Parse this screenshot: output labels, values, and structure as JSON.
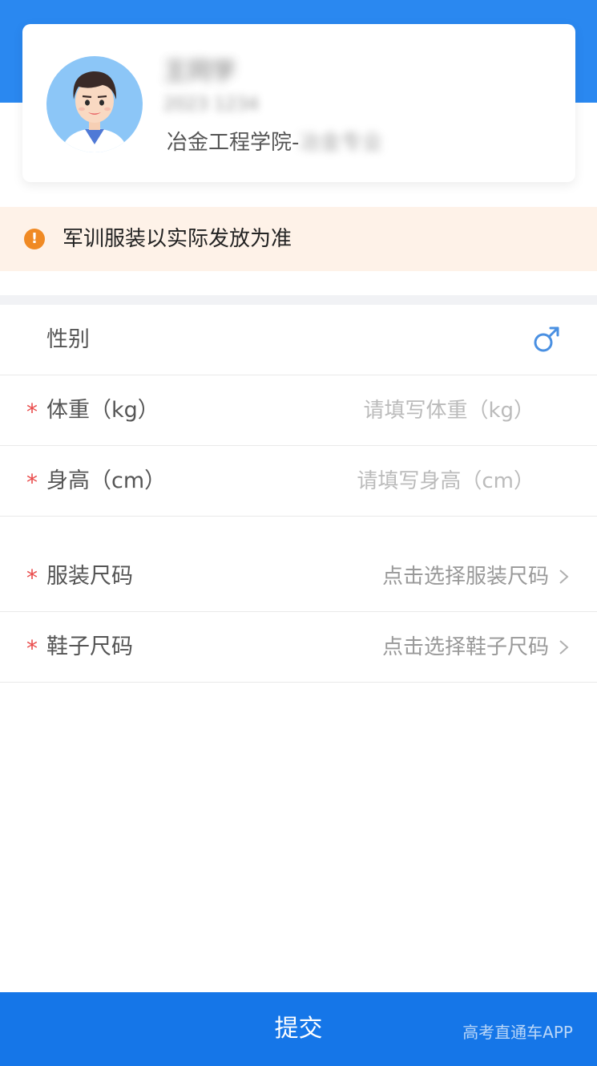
{
  "profile": {
    "name": "王同学",
    "student_id": "2023 1234",
    "department_prefix": "冶金工程学院-",
    "department_suffix": "冶金专业"
  },
  "notice": {
    "icon": "exclamation-circle-icon",
    "text": "军训服装以实际发放为准"
  },
  "form": {
    "gender": {
      "label": "性别",
      "value_icon": "male-icon"
    },
    "weight": {
      "required_mark": "*",
      "label": "体重（kg）",
      "placeholder": "请填写体重（kg）",
      "value": ""
    },
    "height": {
      "required_mark": "*",
      "label": "身高（cm）",
      "placeholder": "请填写身高（cm）",
      "value": ""
    },
    "clothing_size": {
      "required_mark": "*",
      "label": "服装尺码",
      "select_text": "点击选择服装尺码"
    },
    "shoe_size": {
      "required_mark": "*",
      "label": "鞋子尺码",
      "select_text": "点击选择鞋子尺码"
    }
  },
  "submit": {
    "label": "提交"
  },
  "watermark": "高考直通车APP",
  "colors": {
    "header_blue": "#2a88f0",
    "submit_blue": "#1576e8",
    "notice_bg": "#fef2e8",
    "notice_icon": "#f08a24",
    "required_red": "#e94b4b",
    "male_icon": "#4a90e2"
  }
}
